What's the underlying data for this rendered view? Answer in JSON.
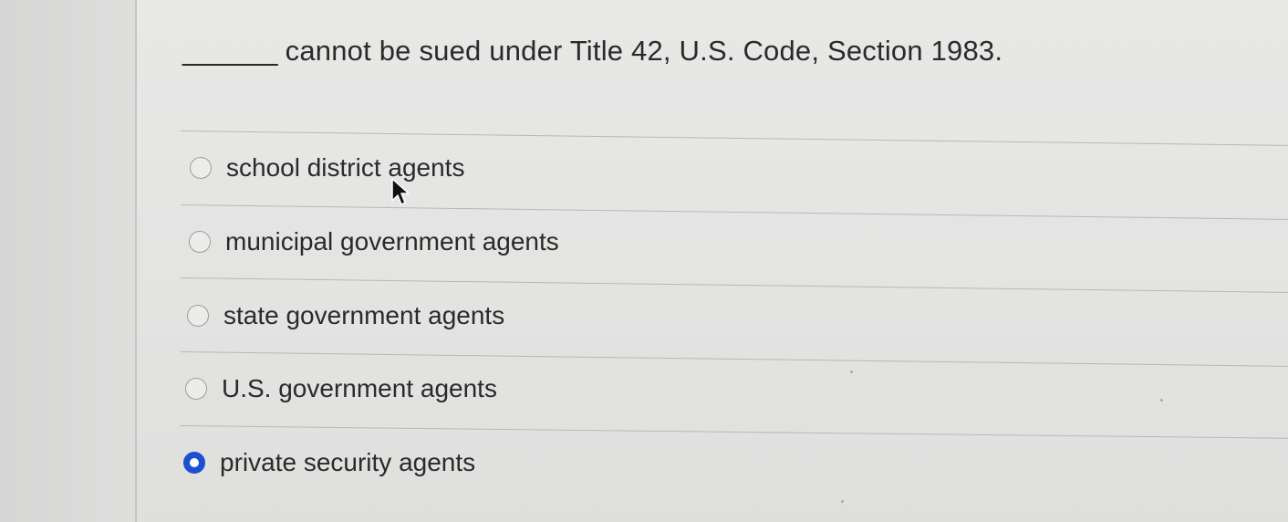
{
  "question": {
    "blank": "______",
    "text": "cannot be sued under Title 42, U.S. Code, Section 1983."
  },
  "options": [
    {
      "label": "school district agents",
      "selected": false
    },
    {
      "label": "municipal government agents",
      "selected": false
    },
    {
      "label": "state government agents",
      "selected": false
    },
    {
      "label": "U.S. government agents",
      "selected": false
    },
    {
      "label": "private security agents",
      "selected": true
    }
  ],
  "colors": {
    "selected_radio": "#1f4fd1",
    "text": "#2a2a2a",
    "background": "#e4e4e3"
  },
  "icons": {
    "cursor": "mouse-pointer-icon"
  }
}
